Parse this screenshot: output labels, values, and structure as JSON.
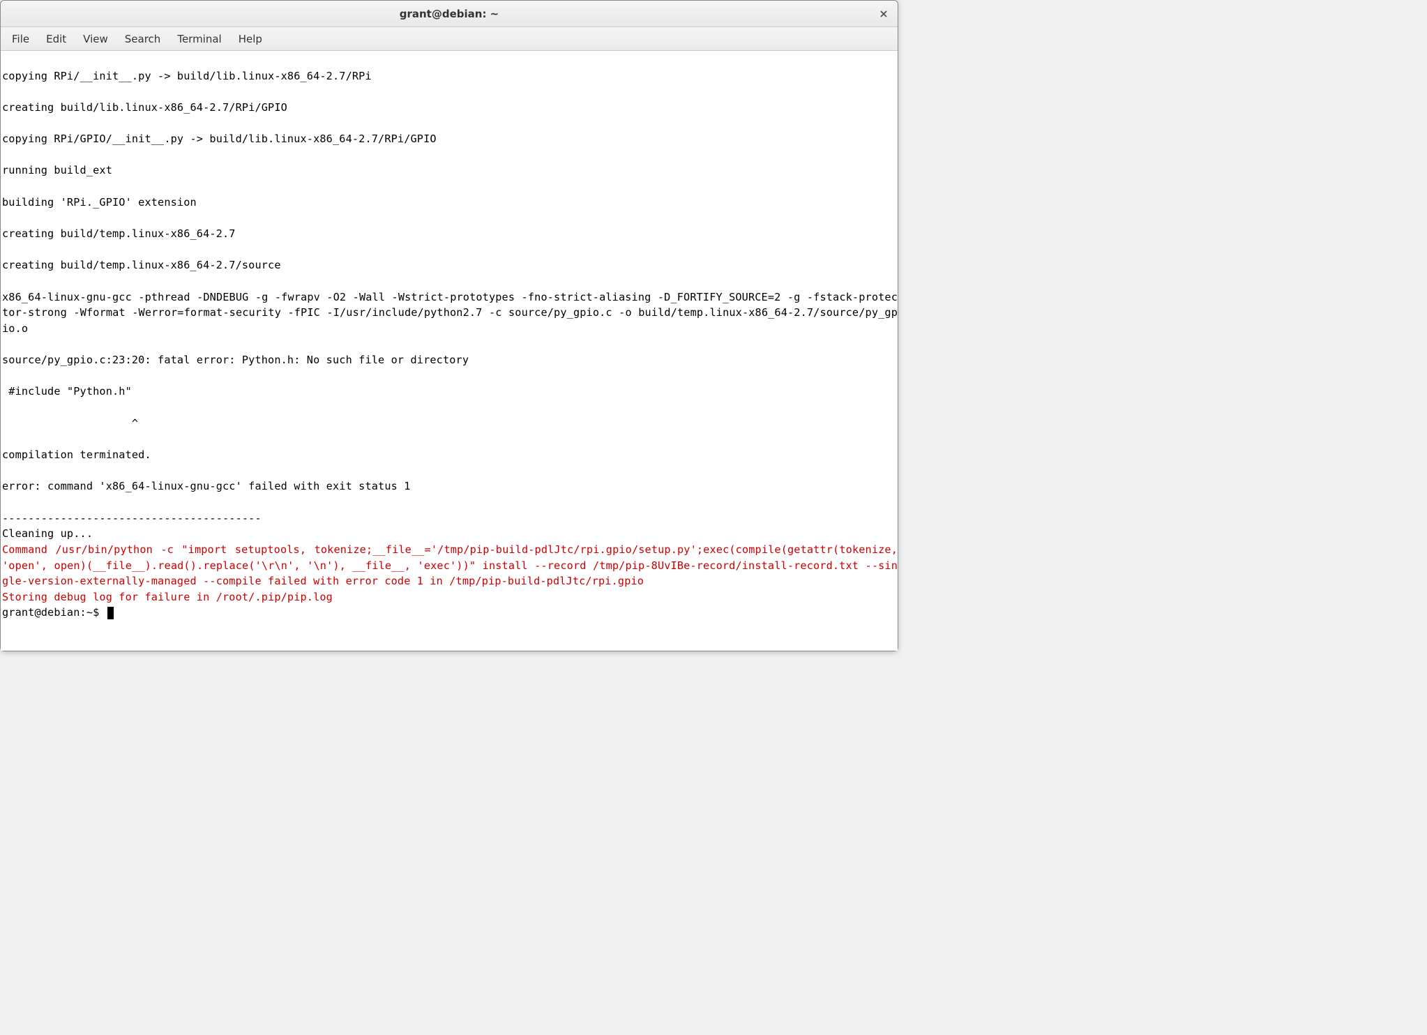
{
  "window": {
    "title": "grant@debian: ~"
  },
  "menu": {
    "file": "File",
    "edit": "Edit",
    "view": "View",
    "search": "Search",
    "terminal": "Terminal",
    "help": "Help"
  },
  "terminal": {
    "lines": [
      {
        "text": "",
        "color": "normal"
      },
      {
        "text": "copying RPi/__init__.py -> build/lib.linux-x86_64-2.7/RPi",
        "color": "normal"
      },
      {
        "text": "",
        "color": "normal"
      },
      {
        "text": "creating build/lib.linux-x86_64-2.7/RPi/GPIO",
        "color": "normal"
      },
      {
        "text": "",
        "color": "normal"
      },
      {
        "text": "copying RPi/GPIO/__init__.py -> build/lib.linux-x86_64-2.7/RPi/GPIO",
        "color": "normal"
      },
      {
        "text": "",
        "color": "normal"
      },
      {
        "text": "running build_ext",
        "color": "normal"
      },
      {
        "text": "",
        "color": "normal"
      },
      {
        "text": "building 'RPi._GPIO' extension",
        "color": "normal"
      },
      {
        "text": "",
        "color": "normal"
      },
      {
        "text": "creating build/temp.linux-x86_64-2.7",
        "color": "normal"
      },
      {
        "text": "",
        "color": "normal"
      },
      {
        "text": "creating build/temp.linux-x86_64-2.7/source",
        "color": "normal"
      },
      {
        "text": "",
        "color": "normal"
      },
      {
        "text": "x86_64-linux-gnu-gcc -pthread -DNDEBUG -g -fwrapv -O2 -Wall -Wstrict-prototypes -fno-strict-aliasing -D_FORTIFY_SOURCE=2 -g -fstack-protector-strong -Wformat -Werror=format-security -fPIC -I/usr/include/python2.7 -c source/py_gpio.c -o build/temp.linux-x86_64-2.7/source/py_gpio.o",
        "color": "normal",
        "justify": true
      },
      {
        "text": "",
        "color": "normal"
      },
      {
        "text": "source/py_gpio.c:23:20: fatal error: Python.h: No such file or directory",
        "color": "normal"
      },
      {
        "text": "",
        "color": "normal"
      },
      {
        "text": " #include \"Python.h\"",
        "color": "normal"
      },
      {
        "text": "",
        "color": "normal"
      },
      {
        "text": "                    ^",
        "color": "normal"
      },
      {
        "text": "",
        "color": "normal"
      },
      {
        "text": "compilation terminated.",
        "color": "normal"
      },
      {
        "text": "",
        "color": "normal"
      },
      {
        "text": "error: command 'x86_64-linux-gnu-gcc' failed with exit status 1",
        "color": "normal"
      },
      {
        "text": "",
        "color": "normal"
      },
      {
        "text": "----------------------------------------",
        "color": "normal"
      },
      {
        "text": "Cleaning up...",
        "color": "normal"
      },
      {
        "text": "Command /usr/bin/python -c \"import setuptools, tokenize;__file__='/tmp/pip-build-pdlJtc/rpi.gpio/setup.py';exec(compile(getattr(tokenize, 'open', open)(__file__).read().replace('\\r\\n', '\\n'), __file__, 'exec'))\" install --record /tmp/pip-8UvIBe-record/install-record.txt --single-version-externally-managed --compile failed with error code 1 in /tmp/pip-build-pdlJtc/rpi.gpio",
        "color": "red",
        "justify": true
      },
      {
        "text": "Storing debug log for failure in /root/.pip/pip.log",
        "color": "red"
      }
    ],
    "prompt": "grant@debian:~$ "
  }
}
